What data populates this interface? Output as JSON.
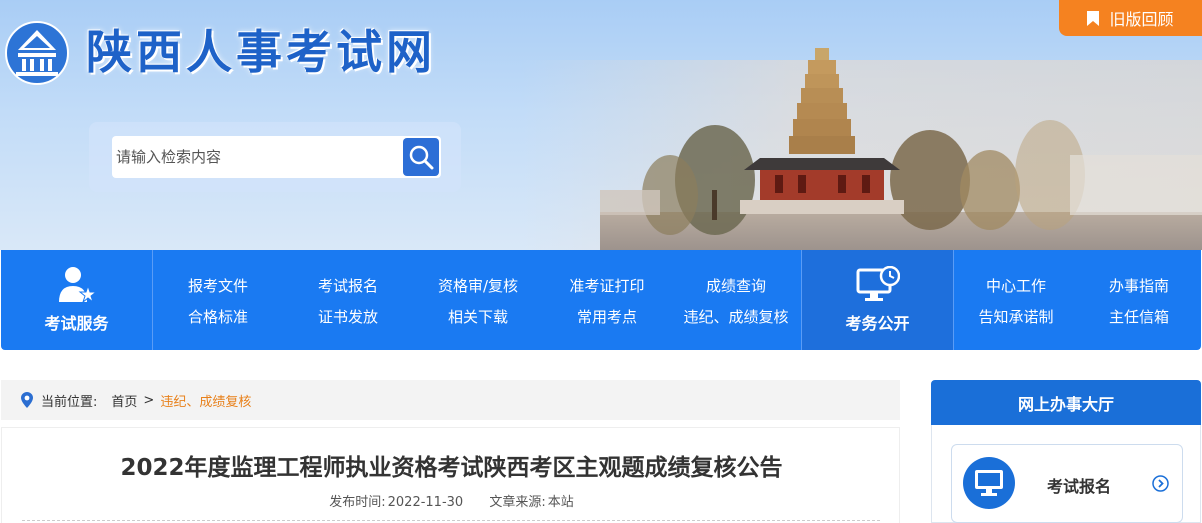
{
  "header": {
    "site_title": "陕西人事考试网",
    "old_version_label": "旧版回顾",
    "search_placeholder": "请输入检索内容"
  },
  "nav": {
    "service_block_label": "考试服务",
    "affairs_block_label": "考务公开",
    "col1": [
      "报考文件",
      "合格标准"
    ],
    "col2": [
      "考试报名",
      "证书发放"
    ],
    "col3": [
      "资格审/复核",
      "相关下载"
    ],
    "col4": [
      "准考证打印",
      "常用考点"
    ],
    "col5": [
      "成绩查询",
      "违纪、成绩复核"
    ],
    "col6": [
      "中心工作",
      "告知承诺制"
    ],
    "col7": [
      "办事指南",
      "主任信箱"
    ]
  },
  "breadcrumb": {
    "prefix": "当前位置:",
    "home": "首页",
    "separator": ">",
    "current": "违纪、成绩复核"
  },
  "article": {
    "title": "2022年度监理工程师执业资格考试陕西考区主观题成绩复核公告",
    "published_label": "发布时间:",
    "published_date": "2022-11-30",
    "source_label": "文章来源:",
    "source_value": "本站"
  },
  "sidebar": {
    "heading": "网上办事大厅",
    "card_label": "考试报名"
  },
  "colors": {
    "brand_blue": "#1a7af2",
    "accent_orange": "#f58220",
    "breadcrumb_current": "#e8801a"
  },
  "icons": {
    "logo": "site-logo-icon",
    "bookmark": "bookmark-icon",
    "search": "search-icon",
    "service": "person-star-icon",
    "affairs": "monitor-clock-icon",
    "location": "location-pin-icon",
    "computer": "computer-icon",
    "arrow": "chevron-right-circle-icon"
  }
}
